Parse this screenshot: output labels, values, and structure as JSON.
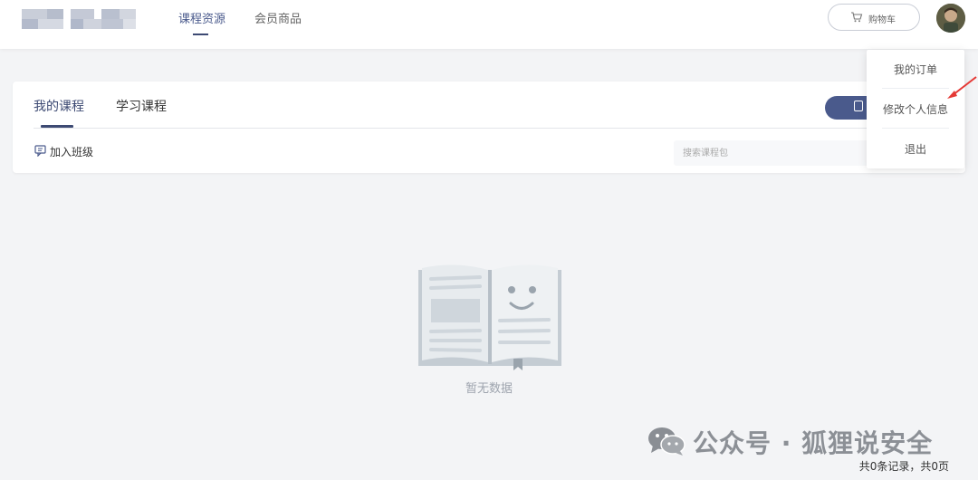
{
  "header": {
    "nav": [
      {
        "label": "课程资源",
        "active": true
      },
      {
        "label": "会员商品",
        "active": false
      }
    ],
    "cart_label": "购物车"
  },
  "tabs": [
    {
      "label": "我的课程",
      "active": true
    },
    {
      "label": "学习课程",
      "active": false
    }
  ],
  "toolbar": {
    "join_class_label": "加入班级",
    "search_placeholder": "搜索课程包"
  },
  "user_menu": {
    "items": [
      "我的订单",
      "修改个人信息",
      "退出"
    ]
  },
  "empty_state": {
    "text": "暂无数据"
  },
  "watermark": {
    "text": "公众号 · 狐狸说安全"
  },
  "pagination": {
    "summary": "共0条记录，共0页"
  },
  "colors": {
    "accent": "#4a5a8c",
    "annotation_arrow": "#e53935"
  }
}
